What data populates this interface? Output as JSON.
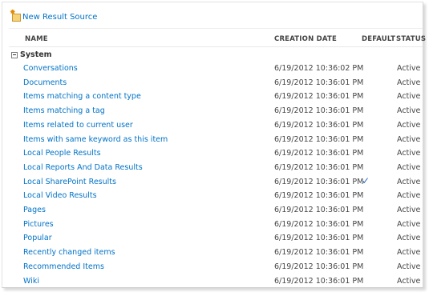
{
  "toolbar": {
    "new_label": "New Result Source",
    "new_icon": "new-result-source-icon"
  },
  "columns": {
    "name": "NAME",
    "creation_date": "CREATION DATE",
    "default": "DEFAULT",
    "status": "STATUS"
  },
  "group": {
    "label": "System",
    "expanded": true
  },
  "colors": {
    "link": "#0072c6",
    "text": "#444444",
    "checkmark": "#2b6cc4"
  },
  "rows": [
    {
      "name": "Conversations",
      "date": "6/19/2012 10:36:02 PM",
      "default": "",
      "status": "Active"
    },
    {
      "name": "Documents",
      "date": "6/19/2012 10:36:01 PM",
      "default": "",
      "status": "Active"
    },
    {
      "name": "Items matching a content type",
      "date": "6/19/2012 10:36:01 PM",
      "default": "",
      "status": "Active"
    },
    {
      "name": "Items matching a tag",
      "date": "6/19/2012 10:36:01 PM",
      "default": "",
      "status": "Active"
    },
    {
      "name": "Items related to current user",
      "date": "6/19/2012 10:36:01 PM",
      "default": "",
      "status": "Active"
    },
    {
      "name": "Items with same keyword as this item",
      "date": "6/19/2012 10:36:01 PM",
      "default": "",
      "status": "Active"
    },
    {
      "name": "Local People Results",
      "date": "6/19/2012 10:36:01 PM",
      "default": "",
      "status": "Active"
    },
    {
      "name": "Local Reports And Data Results",
      "date": "6/19/2012 10:36:01 PM",
      "default": "",
      "status": "Active"
    },
    {
      "name": "Local SharePoint Results",
      "date": "6/19/2012 10:36:01 PM",
      "default": "✓",
      "status": "Active"
    },
    {
      "name": "Local Video Results",
      "date": "6/19/2012 10:36:01 PM",
      "default": "",
      "status": "Active"
    },
    {
      "name": "Pages",
      "date": "6/19/2012 10:36:01 PM",
      "default": "",
      "status": "Active"
    },
    {
      "name": "Pictures",
      "date": "6/19/2012 10:36:01 PM",
      "default": "",
      "status": "Active"
    },
    {
      "name": "Popular",
      "date": "6/19/2012 10:36:01 PM",
      "default": "",
      "status": "Active"
    },
    {
      "name": "Recently changed items",
      "date": "6/19/2012 10:36:01 PM",
      "default": "",
      "status": "Active"
    },
    {
      "name": "Recommended Items",
      "date": "6/19/2012 10:36:01 PM",
      "default": "",
      "status": "Active"
    },
    {
      "name": "Wiki",
      "date": "6/19/2012 10:36:01 PM",
      "default": "",
      "status": "Active"
    }
  ]
}
